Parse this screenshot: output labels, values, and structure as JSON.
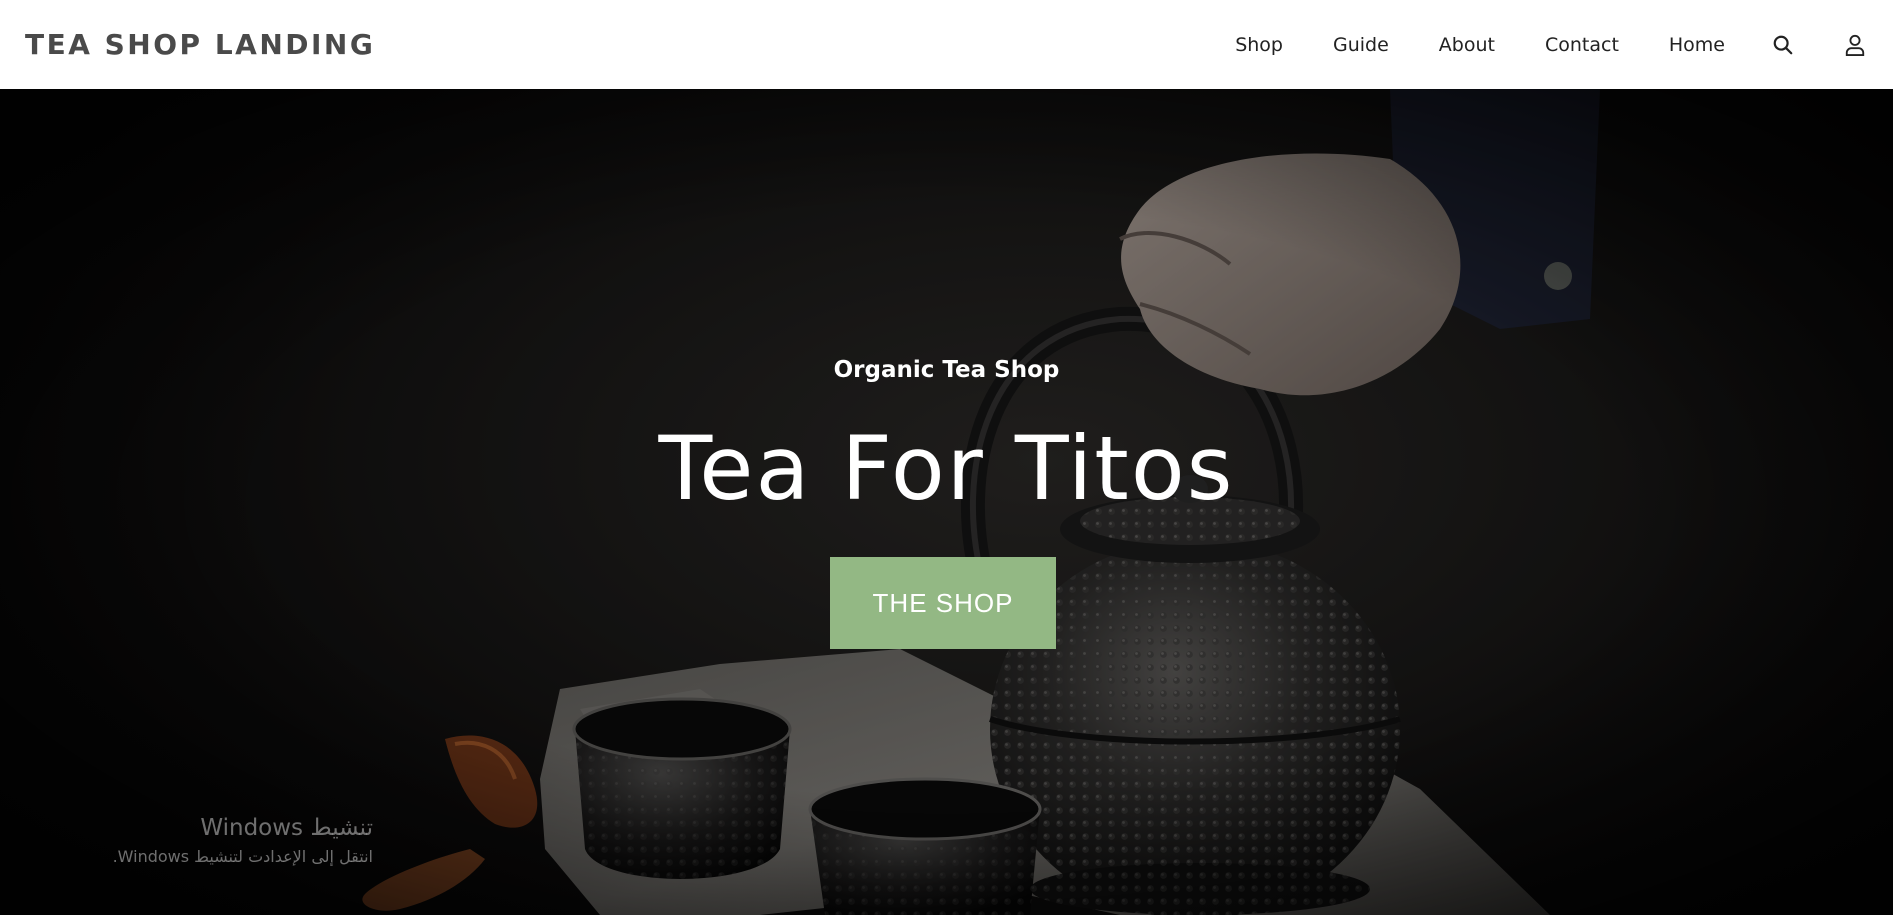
{
  "header": {
    "brand": "TEA SHOP LANDING",
    "nav": [
      {
        "label": "Shop"
      },
      {
        "label": "Guide"
      },
      {
        "label": "About"
      },
      {
        "label": "Contact"
      },
      {
        "label": "Home"
      }
    ],
    "icons": [
      "search-icon",
      "user-icon"
    ]
  },
  "hero": {
    "kicker": "Organic Tea Shop",
    "title": "Tea For Titos",
    "cta_label": "THE SHOP",
    "cta_color": "#93b884",
    "image": "teapot-and-cups-photo"
  },
  "watermark": {
    "title": "تنشيط Windows",
    "subtitle": "انتقل إلى الإعدادت لتنشيط Windows."
  }
}
